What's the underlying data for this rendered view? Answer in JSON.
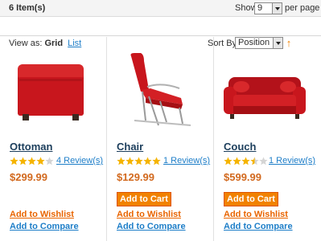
{
  "toolbar": {
    "item_count": "6 Item(s)",
    "show_label": "Show",
    "limit_value": "9",
    "per_page_label": "per page",
    "view_as_label": "View as:",
    "view_grid_label": "Grid",
    "view_list_label": "List",
    "sort_by_label": "Sort By",
    "sort_value": "Position",
    "sort_direction_icon": "up-arrow-icon"
  },
  "products": [
    {
      "name": "Ottoman",
      "rating_stars": 4,
      "reviews_label": "4 Review(s)",
      "price": "$299.99",
      "add_to_cart": "",
      "wishlist": "Add to Wishlist",
      "compare": "Add to Compare"
    },
    {
      "name": "Chair",
      "rating_stars": 5,
      "reviews_label": "1 Review(s)",
      "price": "$129.99",
      "add_to_cart": "Add to Cart",
      "wishlist": "Add to Wishlist",
      "compare": "Add to Compare"
    },
    {
      "name": "Couch",
      "rating_stars": 3.5,
      "reviews_label": "1 Review(s)",
      "price": "$599.99",
      "add_to_cart": "Add to Cart",
      "wishlist": "Add to Wishlist",
      "compare": "Add to Compare"
    }
  ],
  "colors": {
    "accent_orange": "#f18200",
    "link_blue": "#1e7ec8",
    "price": "#d2691e",
    "star_fill": "#f5b400",
    "product_red": "#c8161d"
  }
}
